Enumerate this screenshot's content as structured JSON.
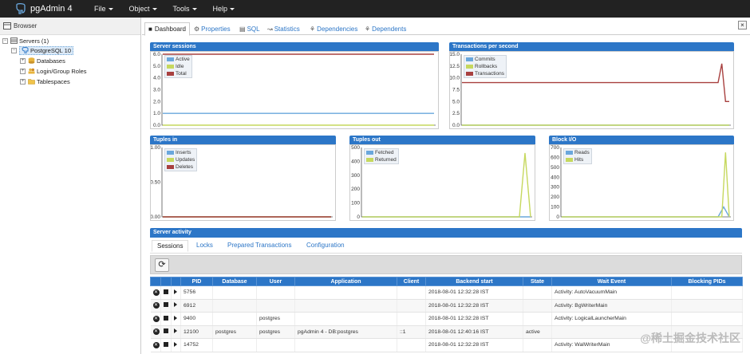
{
  "app": {
    "title": "pgAdmin 4"
  },
  "menu": [
    {
      "label": "File"
    },
    {
      "label": "Object"
    },
    {
      "label": "Tools"
    },
    {
      "label": "Help"
    }
  ],
  "browser": {
    "title": "Browser",
    "tree": [
      {
        "label": "Servers (1)"
      },
      {
        "label": "PostgreSQL 10"
      },
      {
        "label": "Databases"
      },
      {
        "label": "Login/Group Roles"
      },
      {
        "label": "Tablespaces"
      }
    ]
  },
  "tabs": [
    {
      "label": "Dashboard"
    },
    {
      "label": "Properties"
    },
    {
      "label": "SQL"
    },
    {
      "label": "Statistics"
    },
    {
      "label": "Dependencies"
    },
    {
      "label": "Dependents"
    }
  ],
  "close_label": "×",
  "colors": {
    "accent": "#2c76c7",
    "navbar": "#222222",
    "blue": "#6aa7dc",
    "green": "#c6d85e",
    "red": "#a8403f"
  },
  "chart_data": [
    {
      "type": "line",
      "title": "Server sessions",
      "yticks": [
        "6.0",
        "5.0",
        "4.0",
        "3.0",
        "2.0",
        "1.0",
        "0.0"
      ],
      "ylim": [
        0,
        6
      ],
      "series": [
        {
          "name": "Active",
          "color": "#6aa7dc",
          "tail": [
            1,
            1,
            1,
            1
          ]
        },
        {
          "name": "Idle",
          "color": "#c6d85e",
          "tail": [
            0,
            0,
            0,
            0
          ]
        },
        {
          "name": "Total",
          "color": "#a8403f",
          "tail": [
            6,
            6,
            6,
            6
          ]
        }
      ]
    },
    {
      "type": "line",
      "title": "Transactions per second",
      "yticks": [
        "15.0",
        "12.5",
        "10.0",
        "7.5",
        "5.0",
        "2.5",
        "0.0"
      ],
      "ylim": [
        0,
        15
      ],
      "series": [
        {
          "name": "Commits",
          "color": "#6aa7dc",
          "tail": [
            0,
            0,
            0
          ]
        },
        {
          "name": "Rollbacks",
          "color": "#c6d85e",
          "tail": [
            0,
            0,
            0
          ]
        },
        {
          "name": "Transactions",
          "color": "#a8403f",
          "tail": [
            9,
            13,
            5,
            5
          ]
        }
      ]
    },
    {
      "type": "line",
      "title": "Tuples in",
      "yticks": [
        "1.00",
        "0.50",
        "0.00"
      ],
      "ylim": [
        0,
        1
      ],
      "series": [
        {
          "name": "Inserts",
          "color": "#6aa7dc",
          "tail": [
            0,
            0
          ]
        },
        {
          "name": "Updates",
          "color": "#c6d85e",
          "tail": [
            0,
            0
          ]
        },
        {
          "name": "Deletes",
          "color": "#a8403f",
          "tail": [
            0,
            0
          ]
        }
      ]
    },
    {
      "type": "line",
      "title": "Tuples out",
      "yticks": [
        "500",
        "400",
        "300",
        "200",
        "100",
        "0"
      ],
      "ylim": [
        0,
        500
      ],
      "series": [
        {
          "name": "Fetched",
          "color": "#6aa7dc",
          "tail": [
            0,
            0,
            0
          ]
        },
        {
          "name": "Returned",
          "color": "#c6d85e",
          "tail": [
            0,
            460,
            0
          ]
        }
      ]
    },
    {
      "type": "line",
      "title": "Block I/O",
      "yticks": [
        "700",
        "600",
        "500",
        "400",
        "300",
        "200",
        "100",
        "0"
      ],
      "ylim": [
        0,
        700
      ],
      "series": [
        {
          "name": "Reads",
          "color": "#6aa7dc",
          "tail": [
            0,
            100,
            0
          ]
        },
        {
          "name": "Hits",
          "color": "#c6d85e",
          "tail": [
            0,
            0,
            650,
            0
          ]
        }
      ]
    }
  ],
  "activity": {
    "title": "Server activity",
    "subtabs": [
      {
        "label": "Sessions"
      },
      {
        "label": "Locks"
      },
      {
        "label": "Prepared Transactions"
      },
      {
        "label": "Configuration"
      }
    ],
    "refresh_icon": "⟳",
    "columns": [
      "",
      "",
      "",
      "PID",
      "Database",
      "User",
      "Application",
      "Client",
      "Backend start",
      "State",
      "Wait Event",
      "Blocking PIDs"
    ],
    "rows": [
      {
        "pid": "5756",
        "database": "",
        "user": "",
        "application": "",
        "client": "",
        "backend_start": "2018-08-01 12:32:28 IST",
        "state": "",
        "wait_event": "Activity: AutoVacuumMain",
        "blocking": ""
      },
      {
        "pid": "6912",
        "database": "",
        "user": "",
        "application": "",
        "client": "",
        "backend_start": "2018-08-01 12:32:28 IST",
        "state": "",
        "wait_event": "Activity: BgWriterMain",
        "blocking": ""
      },
      {
        "pid": "9400",
        "database": "",
        "user": "postgres",
        "application": "",
        "client": "",
        "backend_start": "2018-08-01 12:32:28 IST",
        "state": "",
        "wait_event": "Activity: LogicalLauncherMain",
        "blocking": ""
      },
      {
        "pid": "12100",
        "database": "postgres",
        "user": "postgres",
        "application": "pgAdmin 4 - DB:postgres",
        "client": "::1",
        "backend_start": "2018-08-01 12:40:16 IST",
        "state": "active",
        "wait_event": "",
        "blocking": ""
      },
      {
        "pid": "14752",
        "database": "",
        "user": "",
        "application": "",
        "client": "",
        "backend_start": "2018-08-01 12:32:28 IST",
        "state": "",
        "wait_event": "Activity: WalWriterMain",
        "blocking": ""
      }
    ]
  },
  "watermark": "@稀土掘金技术社区"
}
